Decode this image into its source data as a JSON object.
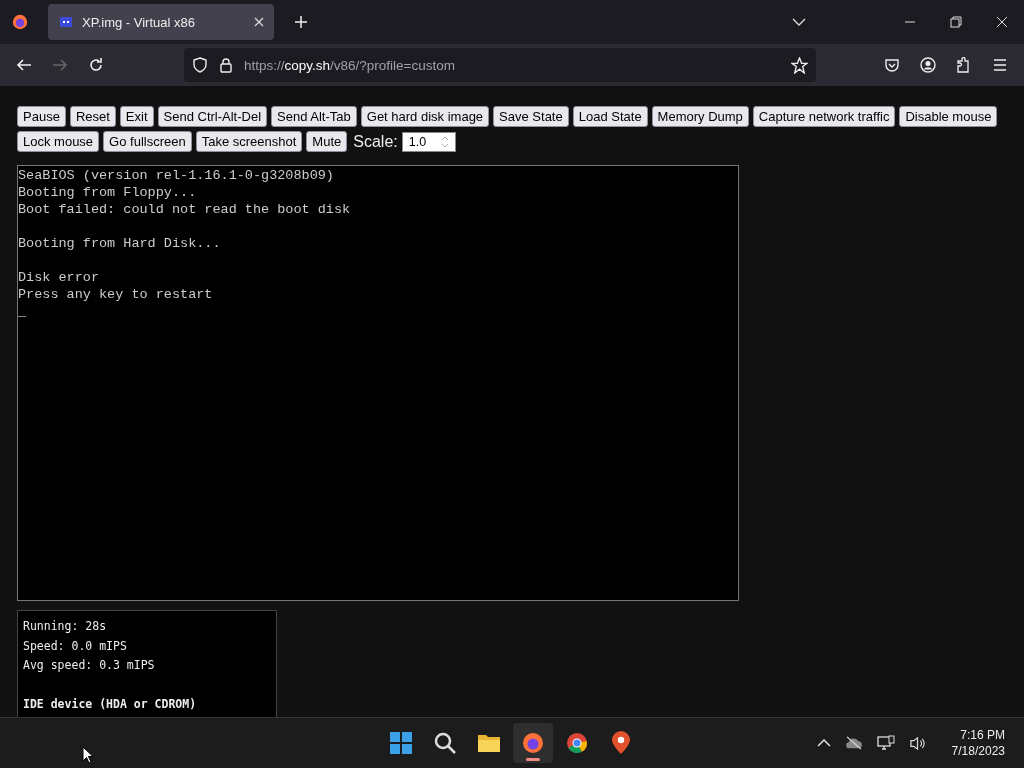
{
  "browser": {
    "tab": {
      "title": "XP.img - Virtual x86",
      "selected": true
    },
    "address": {
      "scheme": "https://",
      "host": "copy.sh",
      "path": "/v86/?profile=custom"
    }
  },
  "toolbar": {
    "buttons": [
      "Pause",
      "Reset",
      "Exit",
      "Send Ctrl-Alt-Del",
      "Send Alt-Tab",
      "Get hard disk image",
      "Save State",
      "Load State",
      "Memory Dump",
      "Capture network traffic",
      "Disable mouse",
      "Lock mouse",
      "Go fullscreen",
      "Take screenshot",
      "Mute"
    ],
    "scale": {
      "label": "Scale:",
      "value": "1.0"
    }
  },
  "screen": {
    "blocks": [
      [
        "SeaBIOS (version rel-1.16.1-0-g3208b09)",
        "Booting from Floppy...",
        "Boot failed: could not read the boot disk"
      ],
      [
        "Booting from Hard Disk..."
      ],
      [
        "Disk error",
        "Press any key to restart",
        "_"
      ]
    ]
  },
  "stats": [
    {
      "kind": "line",
      "text": "Running: 28s"
    },
    {
      "kind": "line",
      "text": "Speed: 0.0 mIPS"
    },
    {
      "kind": "line",
      "text": "Avg speed: 0.3 mIPS"
    },
    {
      "kind": "gap"
    },
    {
      "kind": "heading",
      "text": "IDE device (HDA or CDROM)"
    }
  ],
  "taskbar": {
    "apps": [
      {
        "kind": "start",
        "selected": false
      },
      {
        "kind": "search",
        "selected": false
      },
      {
        "kind": "folder",
        "selected": false
      },
      {
        "kind": "firefox",
        "selected": true
      },
      {
        "kind": "chrome",
        "selected": false
      },
      {
        "kind": "pin",
        "selected": false
      }
    ],
    "time": "7:16 PM",
    "date": "7/18/2023"
  }
}
